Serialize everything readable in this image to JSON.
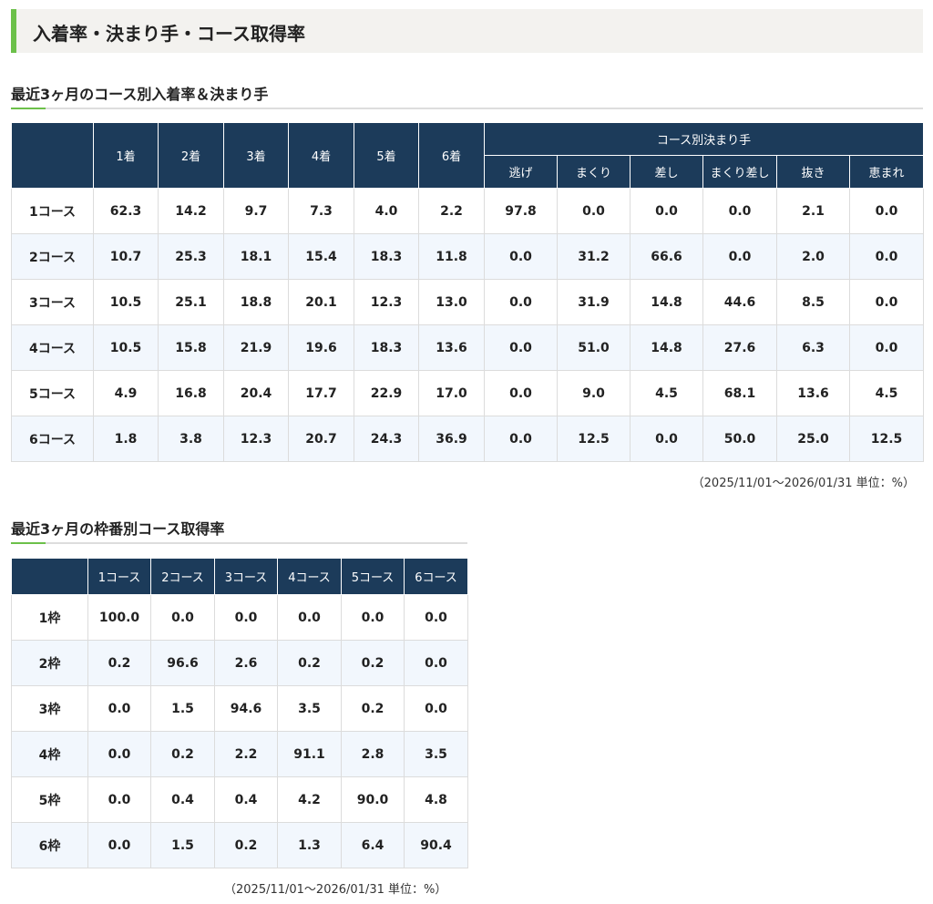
{
  "header": {
    "title": "入着率・決まり手・コース取得率"
  },
  "section1": {
    "title": "最近3ヶ月のコース別入着率＆決まり手",
    "group_header": "コース別決まり手",
    "columns": [
      "1着",
      "2着",
      "3着",
      "4着",
      "5着",
      "6着"
    ],
    "kimarite_columns": [
      "逃げ",
      "まくり",
      "差し",
      "まくり差し",
      "抜き",
      "恵まれ"
    ],
    "rows": [
      {
        "label": "1コース",
        "values": [
          "62.3",
          "14.2",
          "9.7",
          "7.3",
          "4.0",
          "2.2",
          "97.8",
          "0.0",
          "0.0",
          "0.0",
          "2.1",
          "0.0"
        ]
      },
      {
        "label": "2コース",
        "values": [
          "10.7",
          "25.3",
          "18.1",
          "15.4",
          "18.3",
          "11.8",
          "0.0",
          "31.2",
          "66.6",
          "0.0",
          "2.0",
          "0.0"
        ]
      },
      {
        "label": "3コース",
        "values": [
          "10.5",
          "25.1",
          "18.8",
          "20.1",
          "12.3",
          "13.0",
          "0.0",
          "31.9",
          "14.8",
          "44.6",
          "8.5",
          "0.0"
        ]
      },
      {
        "label": "4コース",
        "values": [
          "10.5",
          "15.8",
          "21.9",
          "19.6",
          "18.3",
          "13.6",
          "0.0",
          "51.0",
          "14.8",
          "27.6",
          "6.3",
          "0.0"
        ]
      },
      {
        "label": "5コース",
        "values": [
          "4.9",
          "16.8",
          "20.4",
          "17.7",
          "22.9",
          "17.0",
          "0.0",
          "9.0",
          "4.5",
          "68.1",
          "13.6",
          "4.5"
        ]
      },
      {
        "label": "6コース",
        "values": [
          "1.8",
          "3.8",
          "12.3",
          "20.7",
          "24.3",
          "36.9",
          "0.0",
          "12.5",
          "0.0",
          "50.0",
          "25.0",
          "12.5"
        ]
      }
    ],
    "note": "（2025/11/01～2026/01/31 単位：%）"
  },
  "section2": {
    "title": "最近3ヶ月の枠番別コース取得率",
    "columns": [
      "1コース",
      "2コース",
      "3コース",
      "4コース",
      "5コース",
      "6コース"
    ],
    "rows": [
      {
        "label": "1枠",
        "values": [
          "100.0",
          "0.0",
          "0.0",
          "0.0",
          "0.0",
          "0.0"
        ]
      },
      {
        "label": "2枠",
        "values": [
          "0.2",
          "96.6",
          "2.6",
          "0.2",
          "0.2",
          "0.0"
        ]
      },
      {
        "label": "3枠",
        "values": [
          "0.0",
          "1.5",
          "94.6",
          "3.5",
          "0.2",
          "0.0"
        ]
      },
      {
        "label": "4枠",
        "values": [
          "0.0",
          "0.2",
          "2.2",
          "91.1",
          "2.8",
          "3.5"
        ]
      },
      {
        "label": "5枠",
        "values": [
          "0.0",
          "0.4",
          "0.4",
          "4.2",
          "90.0",
          "4.8"
        ]
      },
      {
        "label": "6枠",
        "values": [
          "0.0",
          "1.5",
          "0.2",
          "1.3",
          "6.4",
          "90.4"
        ]
      }
    ],
    "note": "（2025/11/01～2026/01/31 単位：%）"
  }
}
